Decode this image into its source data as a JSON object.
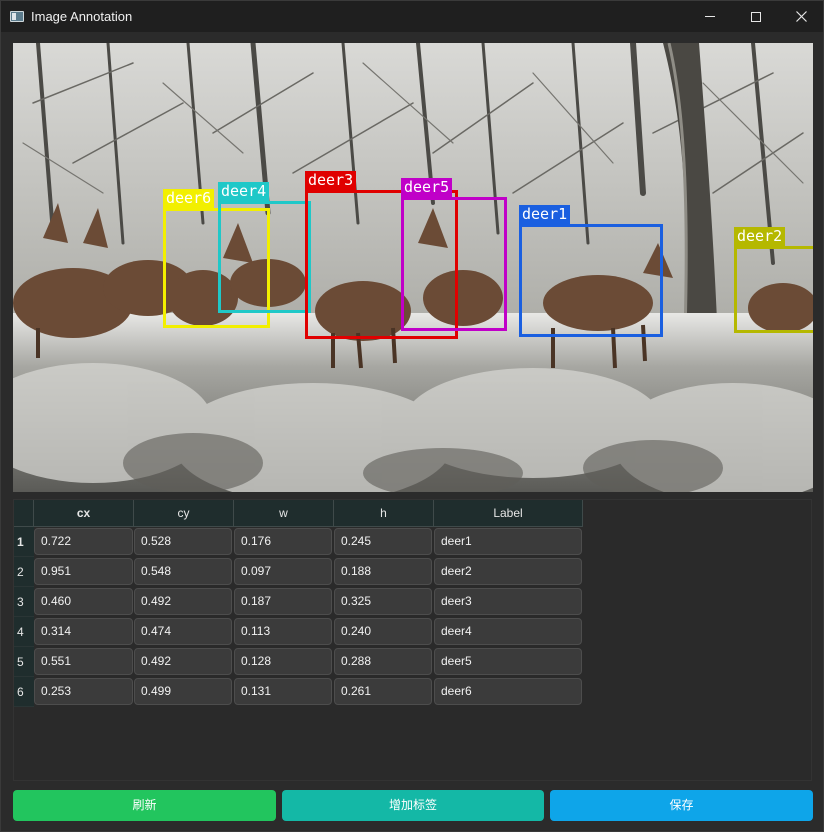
{
  "window": {
    "title": "Image Annotation"
  },
  "image": {
    "annotations": [
      {
        "label": "deer6",
        "color": "#f2ef00"
      },
      {
        "label": "deer4",
        "color": "#1fc8c8"
      },
      {
        "label": "deer3",
        "color": "#e00000"
      },
      {
        "label": "deer5",
        "color": "#c000c8"
      },
      {
        "label": "deer1",
        "color": "#1a5fe0"
      },
      {
        "label": "deer2",
        "color": "#b5b800"
      }
    ]
  },
  "table": {
    "columns": [
      "cx",
      "cy",
      "w",
      "h",
      "Label"
    ],
    "row_numbers": [
      "1",
      "2",
      "3",
      "4",
      "5",
      "6"
    ],
    "rows": [
      [
        "0.722",
        "0.528",
        "0.176",
        "0.245",
        "deer1"
      ],
      [
        "0.951",
        "0.548",
        "0.097",
        "0.188",
        "deer2"
      ],
      [
        "0.460",
        "0.492",
        "0.187",
        "0.325",
        "deer3"
      ],
      [
        "0.314",
        "0.474",
        "0.113",
        "0.240",
        "deer4"
      ],
      [
        "0.551",
        "0.492",
        "0.128",
        "0.288",
        "deer5"
      ],
      [
        "0.253",
        "0.499",
        "0.131",
        "0.261",
        "deer6"
      ]
    ]
  },
  "buttons": {
    "refresh": "刷新",
    "add_label": "增加标签",
    "save": "保存"
  }
}
